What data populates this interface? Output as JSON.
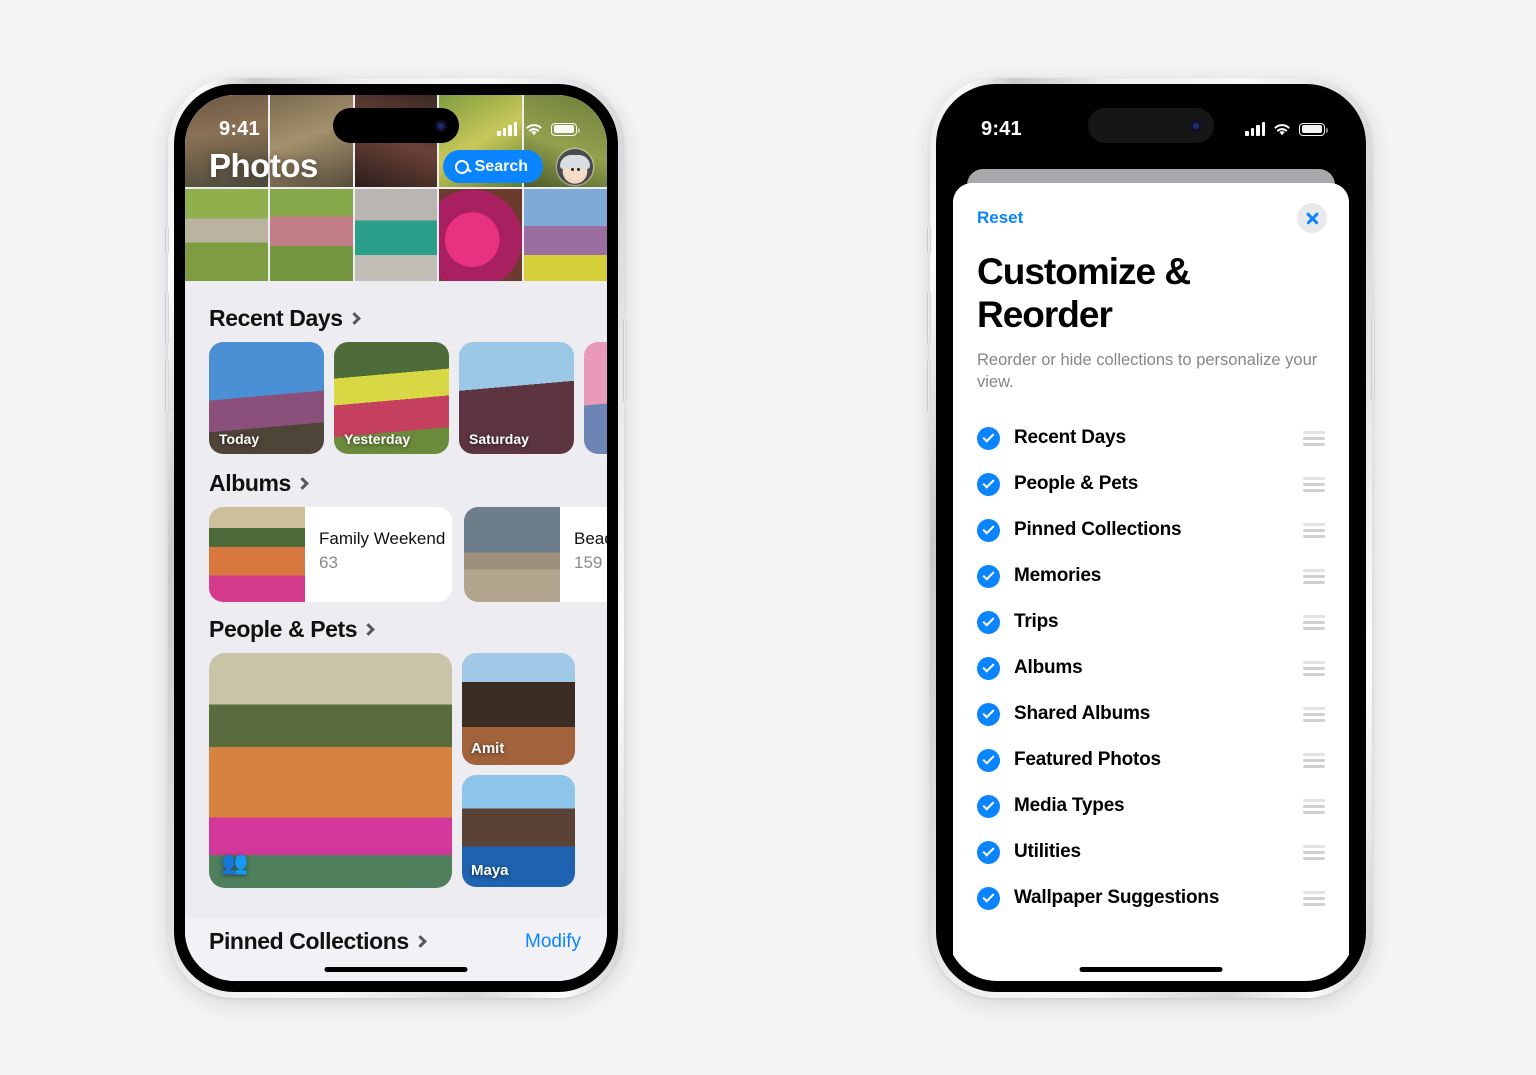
{
  "background_color": "#f5f5f7",
  "accent_blue": "#0a84ff",
  "phones": {
    "left": {
      "status": {
        "time": "9:41",
        "signal_icon": "cellular-signal-icon",
        "wifi_icon": "wifi-icon",
        "battery_icon": "battery-icon"
      },
      "app": {
        "title": "Photos",
        "search_label": "Search",
        "search_icon": "search-icon",
        "avatar_icon": "user-avatar-memoji",
        "sections": [
          {
            "id": "recent-days",
            "title": "Recent Days",
            "chevron_icon": "chevron-right-icon",
            "cards": [
              {
                "label": "Today"
              },
              {
                "label": "Yesterday"
              },
              {
                "label": "Saturday"
              },
              {
                "label": ""
              }
            ]
          },
          {
            "id": "albums",
            "title": "Albums",
            "chevron_icon": "chevron-right-icon",
            "albums": [
              {
                "title": "Family Weekend",
                "count": "63"
              },
              {
                "title": "Beac",
                "count": "159"
              }
            ]
          },
          {
            "id": "people-and-pets",
            "title": "People & Pets",
            "chevron_icon": "chevron-right-icon",
            "group_icon": "people-group-icon",
            "faces": [
              {
                "label": "Amit"
              },
              {
                "label": "Maya"
              }
            ]
          }
        ],
        "bottom_bar": {
          "title": "Pinned Collections",
          "chevron_icon": "chevron-right-icon",
          "modify_label": "Modify"
        }
      }
    },
    "right": {
      "status": {
        "time": "9:41",
        "signal_icon": "cellular-signal-icon",
        "wifi_icon": "wifi-icon",
        "battery_icon": "battery-icon"
      },
      "sheet": {
        "reset_label": "Reset",
        "close_icon": "close-icon",
        "title": "Customize & Reorder",
        "subtitle": "Reorder or hide collections to personalize your view.",
        "items": [
          {
            "label": "Recent Days",
            "checked": true,
            "check_icon": "checkmark-circle-icon",
            "handle_icon": "drag-handle-icon"
          },
          {
            "label": "People & Pets",
            "checked": true,
            "check_icon": "checkmark-circle-icon",
            "handle_icon": "drag-handle-icon"
          },
          {
            "label": "Pinned Collections",
            "checked": true,
            "check_icon": "checkmark-circle-icon",
            "handle_icon": "drag-handle-icon"
          },
          {
            "label": "Memories",
            "checked": true,
            "check_icon": "checkmark-circle-icon",
            "handle_icon": "drag-handle-icon"
          },
          {
            "label": "Trips",
            "checked": true,
            "check_icon": "checkmark-circle-icon",
            "handle_icon": "drag-handle-icon"
          },
          {
            "label": "Albums",
            "checked": true,
            "check_icon": "checkmark-circle-icon",
            "handle_icon": "drag-handle-icon"
          },
          {
            "label": "Shared Albums",
            "checked": true,
            "check_icon": "checkmark-circle-icon",
            "handle_icon": "drag-handle-icon"
          },
          {
            "label": "Featured Photos",
            "checked": true,
            "check_icon": "checkmark-circle-icon",
            "handle_icon": "drag-handle-icon"
          },
          {
            "label": "Media Types",
            "checked": true,
            "check_icon": "checkmark-circle-icon",
            "handle_icon": "drag-handle-icon"
          },
          {
            "label": "Utilities",
            "checked": true,
            "check_icon": "checkmark-circle-icon",
            "handle_icon": "drag-handle-icon"
          },
          {
            "label": "Wallpaper Suggestions",
            "checked": true,
            "check_icon": "checkmark-circle-icon",
            "handle_icon": "drag-handle-icon"
          }
        ]
      }
    }
  }
}
